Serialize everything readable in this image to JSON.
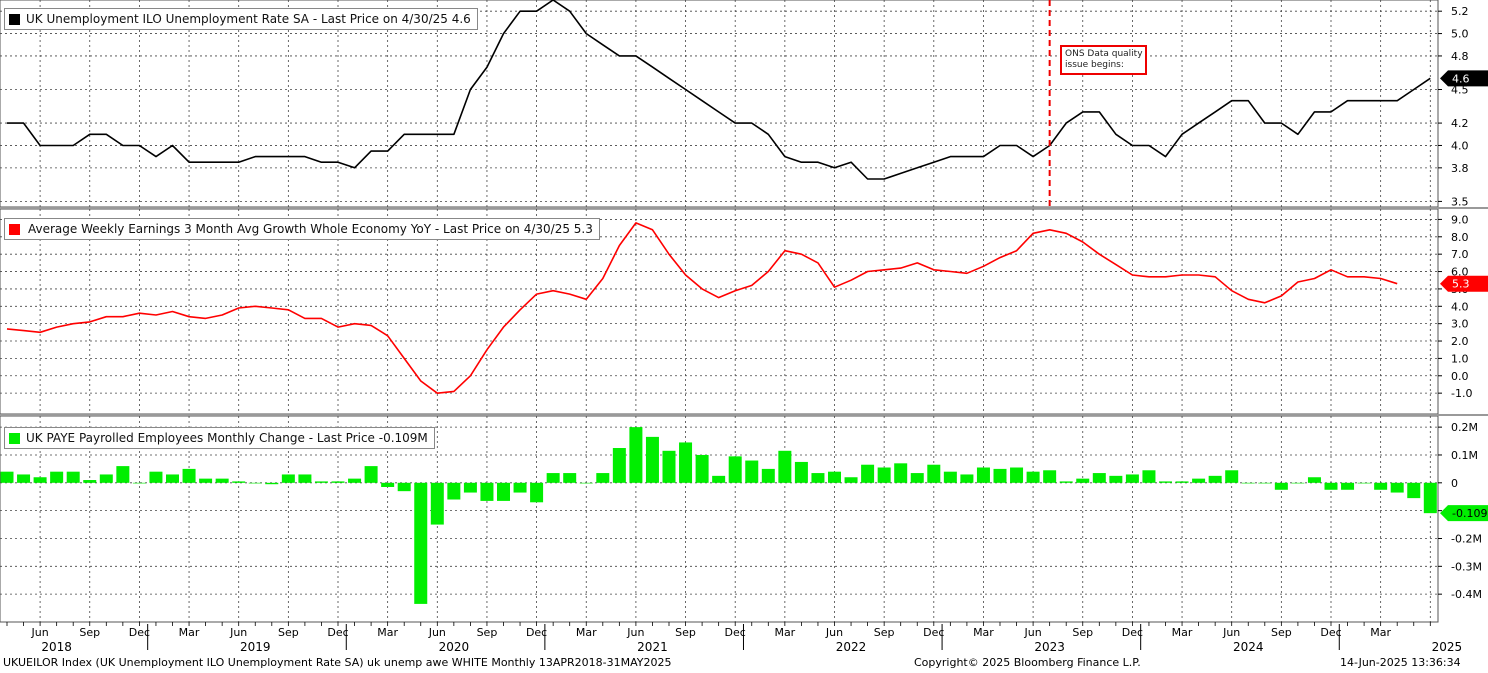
{
  "panels": [
    {
      "legend": "UK Unemployment ILO Unemployment Rate SA - Last Price on 4/30/25 4.6",
      "color": "#000000",
      "type": "line",
      "ylim": [
        3.45,
        5.3
      ],
      "yticks": [
        3.5,
        3.8,
        4.0,
        4.2,
        4.5,
        4.8,
        5.0,
        5.2
      ],
      "ytick_labels": [
        "3.5",
        "3.8",
        "4.0",
        "4.2",
        "4.5",
        "4.8",
        "5.0",
        "5.2"
      ],
      "last_label": "4.6",
      "last_value": 4.6,
      "last_label_bg": "#000000",
      "last_label_fg": "#ffffff"
    },
    {
      "legend": "Average Weekly Earnings 3 Month Avg Growth Whole Economy YoY - Last Price on 4/30/25 5.3",
      "color": "#ff0000",
      "type": "line",
      "ylim": [
        -2.2,
        9.6
      ],
      "yticks": [
        -1.0,
        0.0,
        1.0,
        2.0,
        3.0,
        4.0,
        5.0,
        6.0,
        7.0,
        8.0,
        9.0
      ],
      "ytick_labels": [
        "-1.0",
        "0.0",
        "1.0",
        "2.0",
        "3.0",
        "4.0",
        "5.0",
        "6.0",
        "7.0",
        "8.0",
        "9.0"
      ],
      "last_label": "5.3",
      "last_value": 5.3,
      "last_label_bg": "#ff0000",
      "last_label_fg": "#ffffff"
    },
    {
      "legend": "UK PAYE Payrolled Employees Monthly Change - Last Price -0.109M",
      "color": "#00ee00",
      "type": "bar",
      "ylim": [
        -0.5,
        0.24
      ],
      "yticks": [
        -0.4,
        -0.3,
        -0.2,
        -0.1,
        0.0,
        0.1,
        0.2
      ],
      "ytick_labels": [
        "-0.4M",
        "-0.3M",
        "-0.2M",
        "-0.1M",
        "0",
        "0.1M",
        "0.2M"
      ],
      "last_label": "-0.109M",
      "last_value": -0.109,
      "last_label_bg": "#00ee00",
      "last_label_fg": "#000000"
    }
  ],
  "annotation": {
    "line1": "ONS Data quality",
    "line2": "issue begins:",
    "date": "2023-07",
    "color": "#ee0000"
  },
  "x_axis": {
    "month_labels": [
      "Jun",
      "Sep",
      "Dec",
      "Mar",
      "Jun",
      "Sep",
      "Dec",
      "Mar",
      "Jun",
      "Sep",
      "Dec",
      "Mar",
      "Jun",
      "Sep",
      "Dec",
      "Mar",
      "Jun",
      "Sep",
      "Dec",
      "Mar",
      "Jun",
      "Sep",
      "Dec",
      "Mar",
      "Jun",
      "Sep",
      "Dec",
      "Mar"
    ],
    "year_labels": [
      "2018",
      "2019",
      "2020",
      "2021",
      "2022",
      "2023",
      "2024",
      "2025"
    ]
  },
  "footer": {
    "left": "UKUEILOR Index (UK Unemployment ILO Unemployment Rate SA) uk unemp awe WHITE  Monthly 13APR2018-31MAY2025",
    "middle": "Copyright© 2025 Bloomberg Finance L.P.",
    "right": "14-Jun-2025 13:36:34"
  },
  "chart_data": [
    {
      "type": "line",
      "title": "UK Unemployment ILO Unemployment Rate SA - Last Price on 4/30/25 4.6",
      "x_start": "2018-04",
      "x_frequency": "monthly",
      "series": [
        {
          "name": "UK Unemployment ILO Unemployment Rate SA",
          "values": [
            4.2,
            4.2,
            4.0,
            4.0,
            4.0,
            4.1,
            4.1,
            4.0,
            4.0,
            3.9,
            4.0,
            3.85,
            3.85,
            3.85,
            3.85,
            3.9,
            3.9,
            3.9,
            3.9,
            3.85,
            3.85,
            3.8,
            3.95,
            3.95,
            4.1,
            4.1,
            4.1,
            4.1,
            4.5,
            4.7,
            5.0,
            5.2,
            5.2,
            5.3,
            5.2,
            5.0,
            4.9,
            4.8,
            4.8,
            4.7,
            4.6,
            4.5,
            4.4,
            4.3,
            4.2,
            4.2,
            4.1,
            3.9,
            3.85,
            3.85,
            3.8,
            3.85,
            3.7,
            3.7,
            3.75,
            3.8,
            3.85,
            3.9,
            3.9,
            3.9,
            4.0,
            4.0,
            3.9,
            4.0,
            4.2,
            4.3,
            4.3,
            4.1,
            4.0,
            4.0,
            3.9,
            4.1,
            4.2,
            4.3,
            4.4,
            4.4,
            4.2,
            4.2,
            4.1,
            4.3,
            4.3,
            4.4,
            4.4,
            4.4,
            4.4,
            4.5,
            4.6
          ]
        }
      ],
      "ylim": [
        3.45,
        5.3
      ]
    },
    {
      "type": "line",
      "title": "Average Weekly Earnings 3 Month Avg Growth Whole Economy YoY - Last Price on 4/30/25 5.3",
      "x_start": "2018-04",
      "x_frequency": "monthly",
      "series": [
        {
          "name": "Average Weekly Earnings 3 Month Avg Growth Whole Economy YoY",
          "values": [
            2.7,
            2.6,
            2.5,
            2.8,
            3.0,
            3.1,
            3.4,
            3.4,
            3.6,
            3.5,
            3.7,
            3.4,
            3.3,
            3.5,
            3.9,
            4.0,
            3.9,
            3.8,
            3.3,
            3.3,
            2.8,
            3.0,
            2.9,
            2.3,
            1.0,
            -0.3,
            -1.0,
            -0.9,
            0.0,
            1.5,
            2.8,
            3.8,
            4.7,
            4.9,
            4.7,
            4.4,
            5.6,
            7.5,
            8.8,
            8.4,
            7.0,
            5.8,
            5.0,
            4.5,
            4.9,
            5.2,
            6.0,
            7.2,
            7.0,
            6.5,
            5.1,
            5.5,
            6.0,
            6.1,
            6.2,
            6.5,
            6.1,
            6.0,
            5.9,
            6.3,
            6.8,
            7.2,
            8.2,
            8.4,
            8.2,
            7.7,
            7.0,
            6.4,
            5.8,
            5.7,
            5.7,
            5.8,
            5.8,
            5.7,
            4.9,
            4.4,
            4.2,
            4.6,
            5.4,
            5.6,
            6.1,
            5.7,
            5.7,
            5.6,
            5.3
          ]
        }
      ],
      "ylim": [
        -2.2,
        9.6
      ]
    },
    {
      "type": "bar",
      "title": "UK PAYE Payrolled Employees Monthly Change - Last Price -0.109M",
      "x_start": "2018-04",
      "x_frequency": "monthly",
      "series": [
        {
          "name": "UK PAYE Payrolled Employees Monthly Change",
          "values": [
            0.04,
            0.03,
            0.02,
            0.04,
            0.04,
            0.01,
            0.03,
            0.06,
            0.0,
            0.04,
            0.03,
            0.05,
            0.015,
            0.015,
            0.005,
            0.0,
            -0.005,
            0.03,
            0.03,
            0.005,
            0.005,
            0.015,
            0.06,
            -0.015,
            -0.03,
            -0.435,
            -0.15,
            -0.06,
            -0.035,
            -0.065,
            -0.065,
            -0.035,
            -0.07,
            0.035,
            0.035,
            0.0,
            0.035,
            0.125,
            0.2,
            0.165,
            0.115,
            0.145,
            0.1,
            0.025,
            0.095,
            0.08,
            0.05,
            0.115,
            0.075,
            0.035,
            0.04,
            0.02,
            0.065,
            0.055,
            0.07,
            0.035,
            0.065,
            0.04,
            0.03,
            0.055,
            0.05,
            0.055,
            0.04,
            0.045,
            0.005,
            0.015,
            0.035,
            0.025,
            0.03,
            0.045,
            0.005,
            0.005,
            0.015,
            0.025,
            0.045,
            0.0,
            0.0,
            -0.025,
            0.0,
            0.02,
            -0.025,
            -0.025,
            0.0,
            -0.025,
            -0.035,
            -0.055,
            -0.109
          ]
        }
      ],
      "ylim": [
        -0.5,
        0.24
      ]
    }
  ]
}
